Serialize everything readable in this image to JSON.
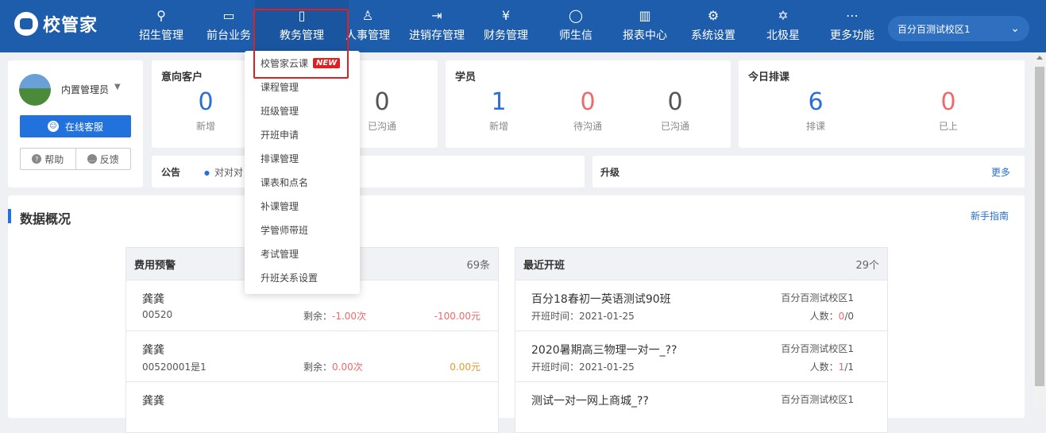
{
  "brand": {
    "name": "校管家"
  },
  "nav": [
    {
      "label": "招生管理",
      "icon": "user-plus-icon"
    },
    {
      "label": "前台业务",
      "icon": "monitor-icon"
    },
    {
      "label": "教务管理",
      "icon": "book-icon"
    },
    {
      "label": "人事管理",
      "icon": "person-icon"
    },
    {
      "label": "进销存管理",
      "icon": "box-arrow-icon"
    },
    {
      "label": "财务管理",
      "icon": "yen-shield-icon"
    },
    {
      "label": "师生信",
      "icon": "chat-icon"
    },
    {
      "label": "报表中心",
      "icon": "bar-chart-icon"
    },
    {
      "label": "系统设置",
      "icon": "gear-icon"
    },
    {
      "label": "北极星",
      "icon": "star-icon"
    },
    {
      "label": "更多功能",
      "icon": "more-icon"
    }
  ],
  "campus": {
    "label": "百分百测试校区1"
  },
  "user": {
    "name": "内置管理员",
    "service_label": "在线客服",
    "help_label": "帮助",
    "feedback_label": "反馈"
  },
  "intent_customers": {
    "title": "意向客户",
    "stats": [
      {
        "value": "0",
        "label": "新增"
      },
      {
        "value": "0",
        "label": "已沟通"
      }
    ]
  },
  "students": {
    "title": "学员",
    "stats": [
      {
        "value": "1",
        "label": "新增"
      },
      {
        "value": "0",
        "label": "待沟通"
      },
      {
        "value": "0",
        "label": "已沟通"
      }
    ]
  },
  "today": {
    "title": "今日排课",
    "stats": [
      {
        "value": "6",
        "label": "排课"
      },
      {
        "value": "0",
        "label": "已上"
      }
    ]
  },
  "notice": {
    "title": "公告",
    "item": "对对对"
  },
  "upgrade": {
    "title": "升级",
    "more": "更多"
  },
  "overview": {
    "title": "数据概况",
    "guide": "新手指南"
  },
  "fee_alert": {
    "title": "费用预警",
    "count": "69条",
    "rows": [
      {
        "name": "龚龚",
        "code": "00520",
        "remain_label": "剩余：",
        "remain": "-1.00次",
        "amount": "-100.00元"
      },
      {
        "name": "龚龚",
        "code": "00520001是1",
        "remain_label": "剩余：",
        "remain": "0.00次",
        "amount": "0.00元"
      },
      {
        "name": "龚龚",
        "code": "",
        "remain_label": "",
        "remain": "",
        "amount": ""
      }
    ]
  },
  "recent_classes": {
    "title": "最近开班",
    "count": "29个",
    "rows": [
      {
        "name": "百分18春初一英语测试90班",
        "date_label": "开班时间：",
        "date": "2021-01-25",
        "campus": "百分百测试校区1",
        "people_label": "人数：",
        "people_current": "0",
        "people_total": "/0"
      },
      {
        "name": "2020暑期高三物理一对一_??",
        "date_label": "开班时间：",
        "date": "2021-01-25",
        "campus": "百分百测试校区1",
        "people_label": "人数：",
        "people_current": "1",
        "people_total": "/1"
      },
      {
        "name": "测试一对一网上商城_??",
        "date_label": "",
        "date": "",
        "campus": "百分百测试校区1",
        "people_label": "",
        "people_current": "",
        "people_total": ""
      }
    ]
  },
  "dropdown": {
    "items": [
      "校管家云课",
      "课程管理",
      "班级管理",
      "开班申请",
      "排课管理",
      "课表和点名",
      "补课管理",
      "学管师带班",
      "考试管理",
      "升班关系设置"
    ],
    "new_badge": "NEW"
  }
}
